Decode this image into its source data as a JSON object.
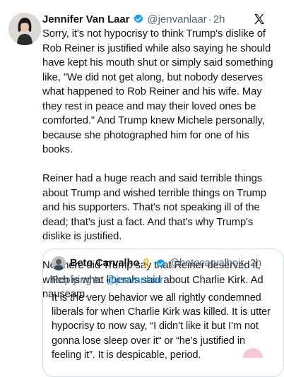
{
  "post": {
    "author_name": "Jennifer Van Laar",
    "handle": "@jenvanlaar",
    "dot": "·",
    "time": "2h",
    "paragraphs": [
      "Sorry, it's not hypocrisy to think Trump's dislike of Rob Reiner is justified while also saying he should have kept his mouth shut or simply said something like, \"We did not get along, but nobody deserves what happened to Rob Reiner and his wife. May they rest in peace and may their loved ones be comforted.\" And Trump knew Michele personally, because she photographed him for one of his books.",
      "Reiner had a huge reach and said terrible things about Trump and wished terrible things on Trump and his supporters. That's not speaking ill of the dead; that's just a fact. And that's why Trump's dislike is justified.",
      "Nowhere did Trump say that Reiner deserved it, which is what liberals said about Charlie Kirk. Ad nauseam."
    ]
  },
  "quote": {
    "author_name": "Beto Carvalho",
    "handle": "@betocarvalhojr",
    "dot": "·",
    "time": "2h",
    "replying_prefix": "Replying to",
    "replying_handle": "@jenvanlaar",
    "text": "It is the very behavior we all rightly condemned liberals for when Charlie Kirk was killed. It is utter hypocrisy to now say, “I didn’t like it but I’m not gonna lose sleep over it“ or “he’s justified in feeling it”. It is despicable, period."
  },
  "colors": {
    "verified": "#1d9bf0",
    "secondary_text": "#536471",
    "ribbon": "#f4c430"
  },
  "icons": {
    "verified": "verified-badge-icon",
    "platform": "x-logo-icon",
    "ribbon": "ribbon-icon"
  }
}
